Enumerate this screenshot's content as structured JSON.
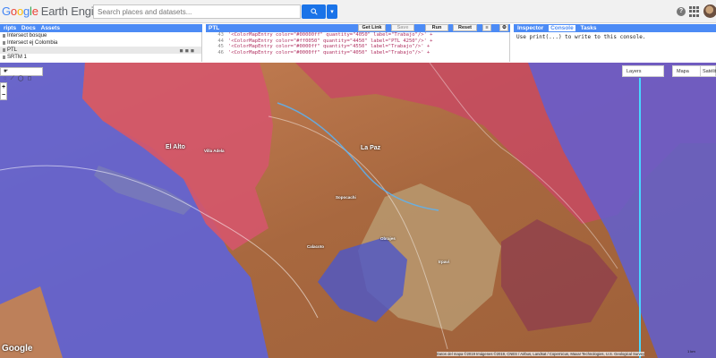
{
  "header": {
    "logo_google": "Google",
    "logo_product": "Earth Engine",
    "search_placeholder": "Search places and datasets..."
  },
  "left_panel": {
    "tabs": [
      "ripts",
      "Docs",
      "Assets"
    ],
    "items": [
      "Intersect bosque",
      "Intersect ej Colombia",
      "PTL",
      "SRTM 1"
    ]
  },
  "code_panel": {
    "tab_name": "PTL",
    "buttons": [
      "Get Link",
      "Save",
      "Run",
      "Reset"
    ],
    "lines": [
      {
        "num": "43",
        "text": "'<ColorMapEntry color=\"#00000ff\" quantity=\"4050\" label=\"Trabajo\"/>' +"
      },
      {
        "num": "44",
        "text": "'<ColorMapEntry color=\"#ff0050\" quantity=\"4450\" label=\"PTL 4250\"/>' +"
      },
      {
        "num": "45",
        "text": "'<ColorMapEntry color=\"#0000ff\" quantity=\"4550\" label=\"Trabajo\"/>' +"
      },
      {
        "num": "46",
        "text": "'<ColorMapEntry color=\"#0000ff\" quantity=\"4050\" label=\"Trabajo\"/>' +"
      }
    ]
  },
  "right_panel": {
    "tabs": [
      "Inspector",
      "Console",
      "Tasks"
    ],
    "console_text": "Use print(...) to write to this console."
  },
  "map": {
    "layers_label": "Layers",
    "map_label": "Mapa",
    "satellite_label": "Satélite",
    "places": [
      "La Paz",
      "Sopocachi",
      "Obrajes",
      "El Alto",
      "Villa Adela",
      "Irpavi",
      "Calacoto"
    ],
    "attribution": "Datos del mapa ©2019 Imágenes ©2019, CNES / Airbus, Landsat / Copernicus, Maxar Technologies, U.S. Geological Survey",
    "google_mark": "Google",
    "scale": "1 km"
  },
  "colors": {
    "accent": "#4c8bf5",
    "search_button": "#1a73e8",
    "map_red": "#d9546b",
    "map_blue": "#5c5fd2",
    "map_terrain": "#b77a4f"
  }
}
